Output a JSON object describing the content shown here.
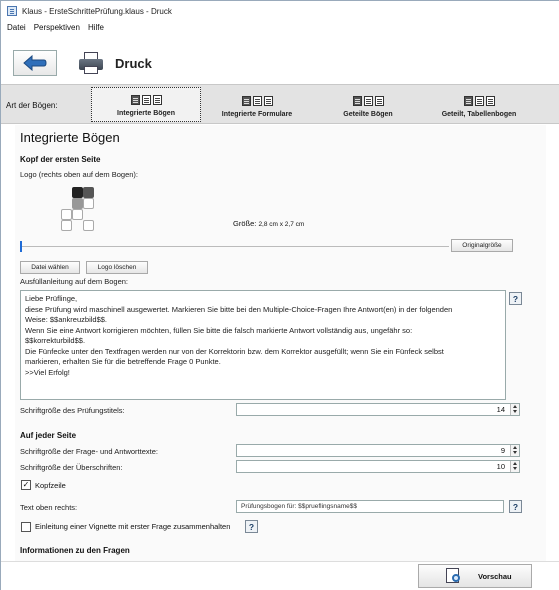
{
  "window": {
    "title": "Klaus - ErsteSchrittePrüfung.klaus - Druck"
  },
  "menu": {
    "items": [
      "Datei",
      "Perspektiven",
      "Hilfe"
    ]
  },
  "toolbar": {
    "title": "Druck",
    "back_icon": "arrow-left-icon",
    "print_icon": "printer-icon"
  },
  "bogen": {
    "label": "Art der Bögen:",
    "tabs": [
      {
        "label": "Integrierte Bögen",
        "selected": true
      },
      {
        "label": "Integrierte Formulare",
        "selected": false
      },
      {
        "label": "Geteilte Bögen",
        "selected": false
      },
      {
        "label": "Geteilt, Tabellenbogen",
        "selected": false
      }
    ]
  },
  "main": {
    "title": "Integrierte Bögen",
    "kopf": {
      "heading": "Kopf der ersten Seite",
      "logo_label": "Logo (rechts oben auf dem Bogen):",
      "size_label": "Größe:",
      "size_value": "2,8 cm x 2,7 cm",
      "original_button": "Originalgröße",
      "choose_file_button": "Datei wählen",
      "delete_logo_button": "Logo löschen",
      "instructions_label": "Ausfüllanleitung auf dem Bogen:",
      "instructions_lines": [
        "Liebe Prüflinge,",
        "diese Prüfung wird maschinell ausgewertet. Markieren Sie bitte bei den Multiple-Choice-Fragen Ihre Antwort(en) in der folgenden",
        "Weise: $$ankreuzbild$$.",
        "Wenn Sie eine Antwort korrigieren möchten, füllen Sie bitte die falsch markierte Antwort vollständig aus, ungefähr so:",
        "$$korrekturbild$$.",
        "Die Fünfecke unter den Textfragen werden nur von der Korrektorin bzw. dem Korrektor ausgefüllt; wenn Sie ein Fünfeck selbst",
        "markieren, erhalten Sie für die betreffende Frage 0 Punkte.",
        ">>Viel Erfolg!"
      ],
      "title_size_label": "Schriftgröße des Prüfungstitels:",
      "title_size_value": "14"
    },
    "jede_seite": {
      "heading": "Auf jeder Seite",
      "qa_size_label": "Schriftgröße der Frage- und Antworttexte:",
      "qa_size_value": "9",
      "heading_size_label": "Schriftgröße der Überschriften:",
      "heading_size_value": "10",
      "header_checkbox_label": "Kopfzeile",
      "header_checked": true,
      "top_right_label": "Text oben rechts:",
      "top_right_value": "Prüfungsbogen für: $$prueflingsname$$",
      "vignette_label": "Einleitung einer Vignette mit erster Frage zusammenhalten",
      "vignette_checked": false
    },
    "fragen": {
      "heading": "Informationen zu den Fragen"
    },
    "help_text": "?"
  },
  "footer": {
    "preview_button": "Vorschau",
    "preview_icon": "preview-magnifier-icon"
  }
}
